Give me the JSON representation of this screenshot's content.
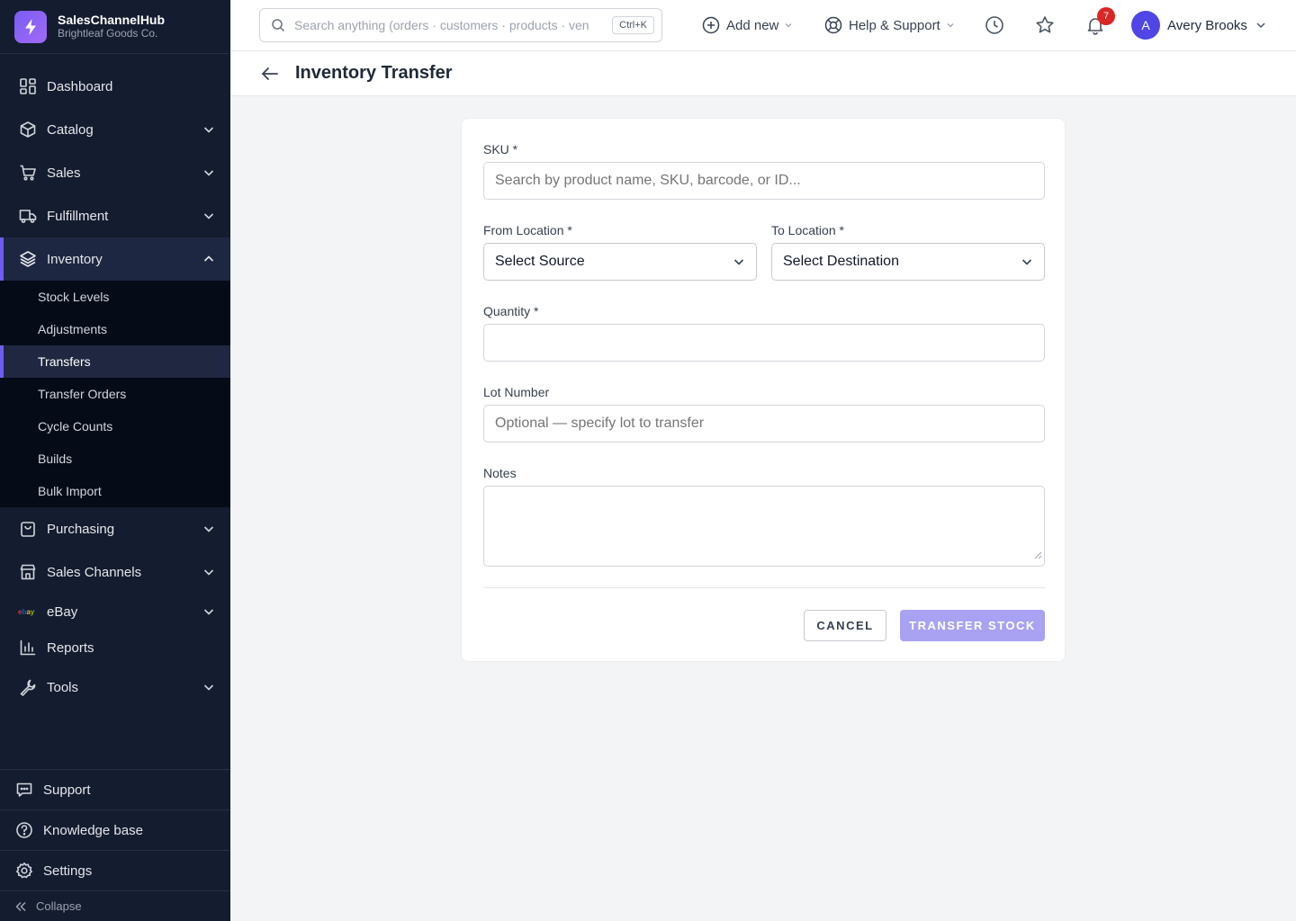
{
  "colors": {
    "sidebar_bg": "#141c2f",
    "accent": "#6f5df0",
    "primary_button_disabled": "#a9a2f3",
    "notification_badge": "#dc2626",
    "avatar_bg": "#4f46e5"
  },
  "brand": {
    "name": "SalesChannelHub",
    "org": "Brightleaf Goods Co.",
    "icon": "lightning-bolt-icon"
  },
  "sidebar": {
    "items": [
      {
        "label": "Dashboard",
        "icon": "dashboard-icon"
      },
      {
        "label": "Catalog",
        "icon": "box-icon",
        "expandable": true
      },
      {
        "label": "Sales",
        "icon": "cart-icon",
        "expandable": true
      },
      {
        "label": "Fulfillment",
        "icon": "truck-icon",
        "expandable": true
      },
      {
        "label": "Inventory",
        "icon": "layers-icon",
        "expandable": true,
        "expanded": true,
        "active": true
      },
      {
        "label": "Purchasing",
        "icon": "shopping-bag-icon",
        "expandable": true
      },
      {
        "label": "Sales Channels",
        "icon": "store-icon",
        "expandable": true
      },
      {
        "label": "eBay",
        "icon": "ebay-logo-icon",
        "expandable": true
      },
      {
        "label": "Reports",
        "icon": "bar-chart-icon"
      },
      {
        "label": "Tools",
        "icon": "wrench-icon",
        "expandable": true
      }
    ],
    "ebay_logo_text": "ebay",
    "inventory_subitems": [
      {
        "label": "Stock Levels"
      },
      {
        "label": "Adjustments"
      },
      {
        "label": "Transfers",
        "active": true
      },
      {
        "label": "Transfer Orders"
      },
      {
        "label": "Cycle Counts"
      },
      {
        "label": "Builds"
      },
      {
        "label": "Bulk Import"
      }
    ],
    "bottom": [
      {
        "label": "Support",
        "icon": "chat-icon"
      },
      {
        "label": "Knowledge base",
        "icon": "help-circle-icon"
      },
      {
        "label": "Settings",
        "icon": "gear-icon"
      }
    ],
    "collapse_label": "Collapse"
  },
  "topbar": {
    "search_placeholder": "Search anything (orders · customers · products · vendors)",
    "search_shortcut": "Ctrl+K",
    "add_new_label": "Add new",
    "help_label": "Help & Support",
    "notification_count": "7",
    "user": {
      "initial": "A",
      "name": "Avery Brooks"
    }
  },
  "page": {
    "title": "Inventory Transfer"
  },
  "form": {
    "sku": {
      "label": "SKU *",
      "placeholder": "Search by product name, SKU, barcode, or ID...",
      "value": ""
    },
    "from_location": {
      "label": "From Location *",
      "selected": "Select Source"
    },
    "to_location": {
      "label": "To Location *",
      "selected": "Select Destination"
    },
    "quantity": {
      "label": "Quantity *",
      "value": ""
    },
    "lot_number": {
      "label": "Lot Number",
      "placeholder": "Optional — specify lot to transfer",
      "value": ""
    },
    "notes": {
      "label": "Notes",
      "value": ""
    },
    "cancel_label": "CANCEL",
    "submit_label": "TRANSFER STOCK",
    "submit_disabled": true
  }
}
